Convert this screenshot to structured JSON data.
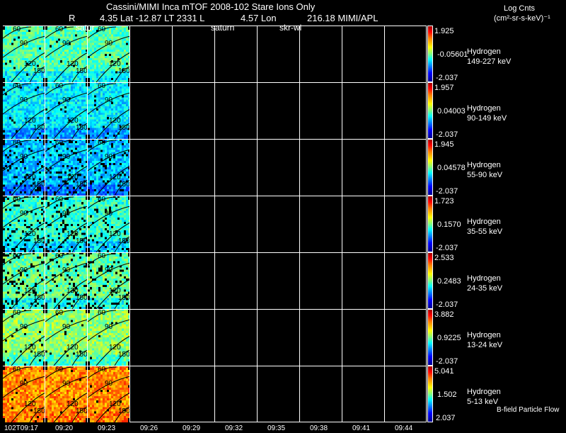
{
  "header": {
    "title": "Cassini/MIMI Inca mTOF  2008-102   Stare   Ions Only",
    "line2_r": "R",
    "line2_main": "4.35 Lat -12.87 LT 2331 L",
    "line2_l": "4.57 Lon",
    "line2_lon": "216.18  MIMI/APL",
    "overlay_satur": "satur",
    "overlay_saturn": "saturn",
    "overlay_skr": "skr-wl"
  },
  "colorbar_title": {
    "line1": "Log Cnts",
    "line2": "(cm²-sr-s-keV)⁻¹"
  },
  "footer_label": "B-field Particle Flow",
  "chart_data": {
    "type": "heatmap",
    "colormap": "jet",
    "panels": [
      {
        "species": "Hydrogen",
        "energy": "149-227 keV",
        "max": "1.925",
        "mid": "-0.05601",
        "min": "-2.037",
        "level": 0.45
      },
      {
        "species": "Hydrogen",
        "energy": "90-149 keV",
        "max": "1.957",
        "mid": "0.04003",
        "min": "-2.037",
        "level": 0.36
      },
      {
        "species": "Hydrogen",
        "energy": "55-90 keV",
        "max": "1.945",
        "mid": "0.04578",
        "min": "-2.037",
        "level": 0.32
      },
      {
        "species": "Hydrogen",
        "energy": "35-55 keV",
        "max": "1.723",
        "mid": "0.1570",
        "min": "-2.037",
        "level": 0.42
      },
      {
        "species": "Hydrogen",
        "energy": "24-35 keV",
        "max": "2.533",
        "mid": "0.2483",
        "min": "-2.037",
        "level": 0.47
      },
      {
        "species": "Hydrogen",
        "energy": "13-24 keV",
        "max": "3.882",
        "mid": "0.9225",
        "min": "-2.037",
        "level": 0.52
      },
      {
        "species": "Hydrogen",
        "energy": "5-13 keV",
        "max": "5.041",
        "mid": "1.502",
        "min": "2.037",
        "level": 0.74
      }
    ],
    "x_ticks": [
      "102T09:17",
      "09:20",
      "09:23",
      "09:26",
      "09:29",
      "09:32",
      "09:35",
      "09:38",
      "09:41",
      "09:44"
    ],
    "images_per_panel": 3,
    "contour_labels": [
      "60",
      "90",
      "120",
      "150"
    ]
  }
}
